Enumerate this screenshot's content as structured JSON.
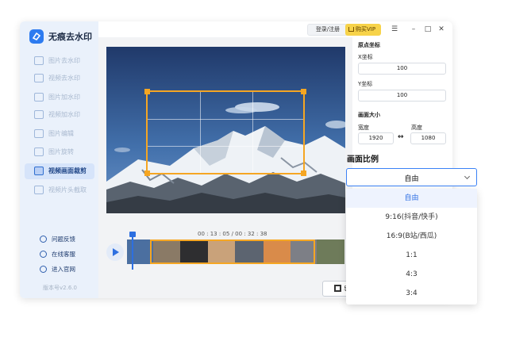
{
  "app": {
    "title": "无痕去水印",
    "version": "版本号v2.6.0"
  },
  "sidebar": {
    "items": [
      {
        "label": "图片去水印",
        "icon": "image-icon",
        "active": false
      },
      {
        "label": "视频去水印",
        "icon": "video-icon",
        "active": false
      },
      {
        "label": "图片加水印",
        "icon": "image-watermark-icon",
        "active": false
      },
      {
        "label": "视频加水印",
        "icon": "video-watermark-icon",
        "active": false
      },
      {
        "label": "图片编辑",
        "icon": "image-edit-icon",
        "active": false
      },
      {
        "label": "图片旋转",
        "icon": "rotate-icon",
        "active": false
      },
      {
        "label": "视频画面裁剪",
        "icon": "crop-icon",
        "active": true
      },
      {
        "label": "视频片头截取",
        "icon": "trim-icon",
        "active": false
      }
    ],
    "footer": [
      {
        "label": "问题反馈",
        "icon": "feedback-icon"
      },
      {
        "label": "在线客服",
        "icon": "support-icon"
      },
      {
        "label": "进入官网",
        "icon": "website-icon"
      }
    ]
  },
  "titlebar": {
    "login": "登录/注册",
    "vip": "购买VIP"
  },
  "props": {
    "origin_title": "原点坐标",
    "x_label": "X坐标",
    "x_value": "100",
    "y_label": "Y坐标",
    "y_value": "100",
    "size_title": "画面大小",
    "width_label": "宽度",
    "width_value": "1920",
    "height_label": "高度",
    "height_value": "1080"
  },
  "timeline": {
    "timecode": "00 : 13 : 05 / 00 : 32 : 38",
    "export_label": "导"
  },
  "ratio": {
    "title": "画面比例",
    "selected": "自由",
    "options": [
      "自由",
      "9:16(抖音/快手)",
      "16:9(B站/西瓜)",
      "1:1",
      "4:3",
      "3:4"
    ],
    "selected_index": 0
  },
  "colors": {
    "accent": "#2d6fe0",
    "crop": "#f5a623",
    "vip": "#f7d34a"
  }
}
